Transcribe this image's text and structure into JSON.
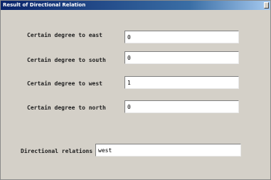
{
  "window": {
    "title": "Result of Directional Relation"
  },
  "form": {
    "east": {
      "label": "Certain degree to east",
      "value": "0"
    },
    "south": {
      "label": "Certain degree to south",
      "value": "0"
    },
    "west": {
      "label": "Certain degree to west",
      "value": "1"
    },
    "north": {
      "label": "Certain degree to north",
      "value": "0"
    },
    "relations": {
      "label": "Directional relations",
      "value": "west"
    }
  }
}
